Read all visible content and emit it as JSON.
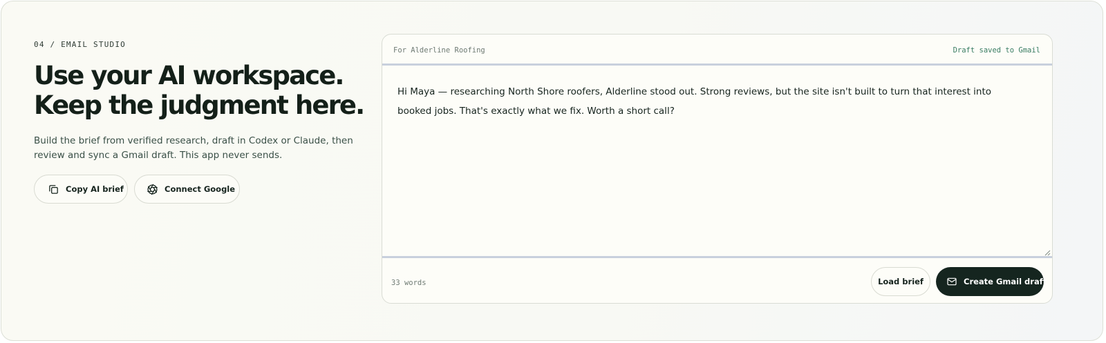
{
  "section": {
    "eyebrow": "04 / EMAIL STUDIO",
    "headline": [
      "Use your AI workspace.",
      "Keep the judgment here."
    ],
    "subtitle": [
      "Build the brief from verified research, draft in Codex or Claude, then",
      "review and sync a Gmail draft. This app never sends."
    ]
  },
  "actions": {
    "copy_brief_label": "Copy AI brief",
    "copy_icon": "copy-icon",
    "connect_google_label": "Connect Google",
    "google_icon": "aperture-icon"
  },
  "draft": {
    "recipient": "For Alderline Roofing",
    "status": "Draft saved to Gmail",
    "body_lines": [
      "Hi Maya — researching North Shore roofers, Alderline stood out. Strong reviews, but the site isn't built to turn that interest into",
      "booked jobs. That's exactly what we fix. Worth a short call?"
    ],
    "word_count": "33 words",
    "load_brief_label": "Load brief",
    "create_draft_label": "Create Gmail draft",
    "mail_icon": "mail-icon"
  },
  "colors": {
    "primary_dark": "#15251f",
    "status_green": "#3a7d63",
    "divider_blue": "#c8d0dd"
  }
}
